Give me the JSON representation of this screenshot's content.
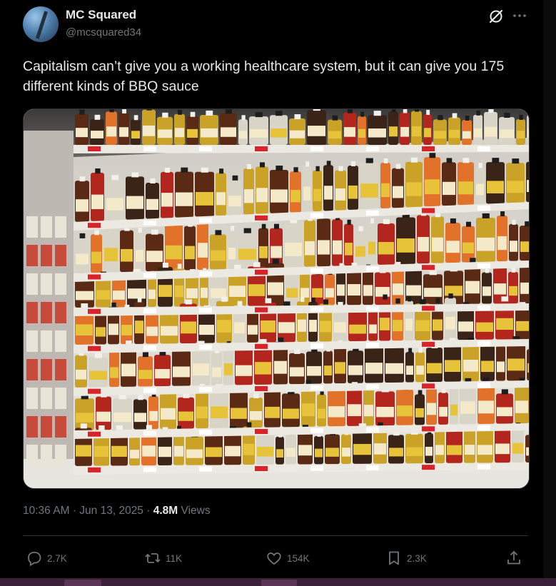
{
  "tweet": {
    "author": {
      "name": "MC Squared",
      "handle": "@mcsquared34"
    },
    "text": "Capitalism can’t give you a working healthcare system, but it can give you 175 different kinds of BBQ sauce",
    "meta": {
      "time": "10:36 AM",
      "date": "Jun 13, 2025",
      "separator": "·",
      "views_count": "4.8M",
      "views_label": "Views"
    },
    "actions": [
      {
        "name": "reply",
        "icon": "reply-icon",
        "count": "2.7K"
      },
      {
        "name": "retweet",
        "icon": "retweet-icon",
        "count": "11K"
      },
      {
        "name": "like",
        "icon": "like-icon",
        "count": "154K"
      },
      {
        "name": "bookmark",
        "icon": "bookmark-icon",
        "count": "2.3K"
      },
      {
        "name": "share",
        "icon": "share-icon"
      }
    ],
    "header_icons": [
      "grok-icon",
      "more-icon"
    ],
    "media": {
      "description_icon": "photo-icon",
      "shelf_colors": [
        "#5a2a14",
        "#c9a227",
        "#d8d4c8",
        "#e2722a",
        "#b3261e",
        "#3a2418"
      ]
    }
  },
  "theme": {
    "background": "#000000",
    "text": "#e7e9ea",
    "muted": "#71767b",
    "divider": "#2f3336"
  }
}
